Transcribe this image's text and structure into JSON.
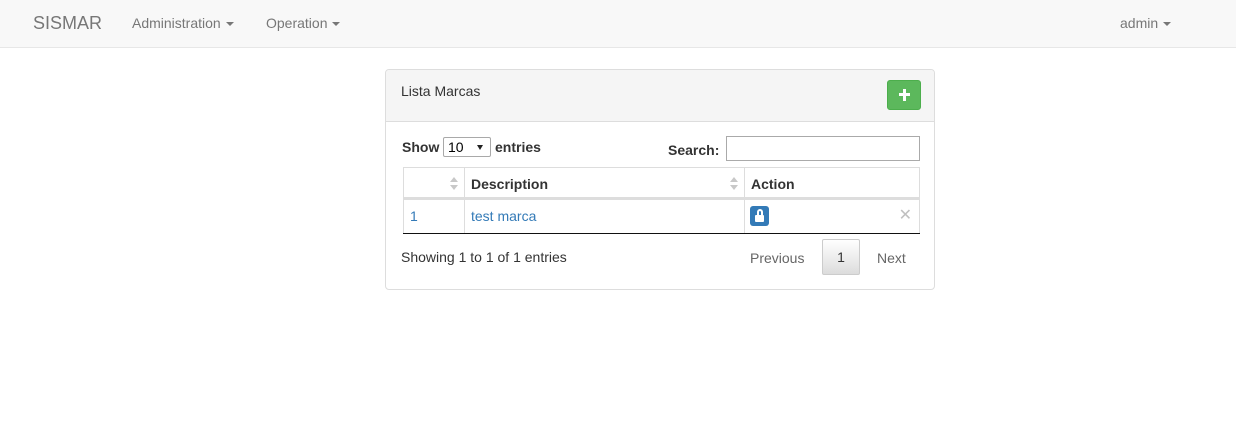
{
  "navbar": {
    "brand": "SISMAR",
    "menus": [
      {
        "label": "Administration"
      },
      {
        "label": "Operation"
      }
    ],
    "user": "admin"
  },
  "panel": {
    "title": "Lista Marcas",
    "add_icon": "plus-icon",
    "add_button_color": "#5cb85c"
  },
  "table_controls": {
    "show_label": "Show",
    "page_length": "10",
    "entries_label": "entries",
    "search_label": "Search:",
    "search_value": ""
  },
  "table": {
    "columns": [
      "",
      "Description",
      "Action"
    ],
    "rows": [
      {
        "id": "1",
        "description": "test marca",
        "action_icon": "unlock-icon",
        "remove_icon": "remove-icon"
      }
    ]
  },
  "footer": {
    "info": "Showing 1 to 1 of 1 entries",
    "previous": "Previous",
    "current_page": "1",
    "next": "Next"
  },
  "colors": {
    "link": "#337ab7",
    "primary": "#337ab7",
    "success": "#5cb85c"
  }
}
